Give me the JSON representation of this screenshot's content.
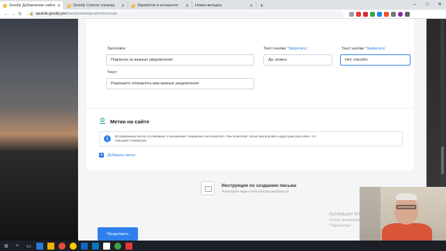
{
  "browser": {
    "tabs": [
      {
        "label": "Goodly Добавление сайта pushm",
        "active": true
      },
      {
        "label": "Goodly Список страниц",
        "active": false
      },
      {
        "label": "Заработок в интернете",
        "active": false
      },
      {
        "label": "Новая вкладка",
        "active": false
      }
    ],
    "url_host": "sputnik.goodly.pro",
    "url_path": "/backend/webpush/site/create"
  },
  "form": {
    "heading_label": "Заголовок",
    "heading_value": "Подписка на важные уведомления",
    "allow_label_prefix": "Текст кнопки ",
    "allow_label_hl": "\"Запретить\"",
    "allow_value": "Да, можно",
    "deny_label_prefix": "Текст кнопки ",
    "deny_label_hl": "\"Запретить\"",
    "deny_value": "Нет, спасибо",
    "text_label": "Текст",
    "text_value": "Разрешите отправлять вам важные уведомления"
  },
  "tags": {
    "title": "Метки на сайте",
    "info": "Встраиваемые метки отслеживают и запоминают поведение пользователя. Они позволяют лучше фильтровать аудиторию рассылки, что повышает конверсию.",
    "add_label": "Добавить метку"
  },
  "instruction": {
    "title": "Инструкция по созданию письма",
    "subtitle": "Посмотрите видео чтобы быстро разобраться"
  },
  "watermark": {
    "line1": "Активация Windows",
    "line2": "Чтобы активировать Windows, перейдите в раздел",
    "line3": "\"Параметры\"."
  },
  "actions": {
    "save_label": "Продолжить"
  },
  "colors": {
    "accent": "#2f80ed"
  }
}
